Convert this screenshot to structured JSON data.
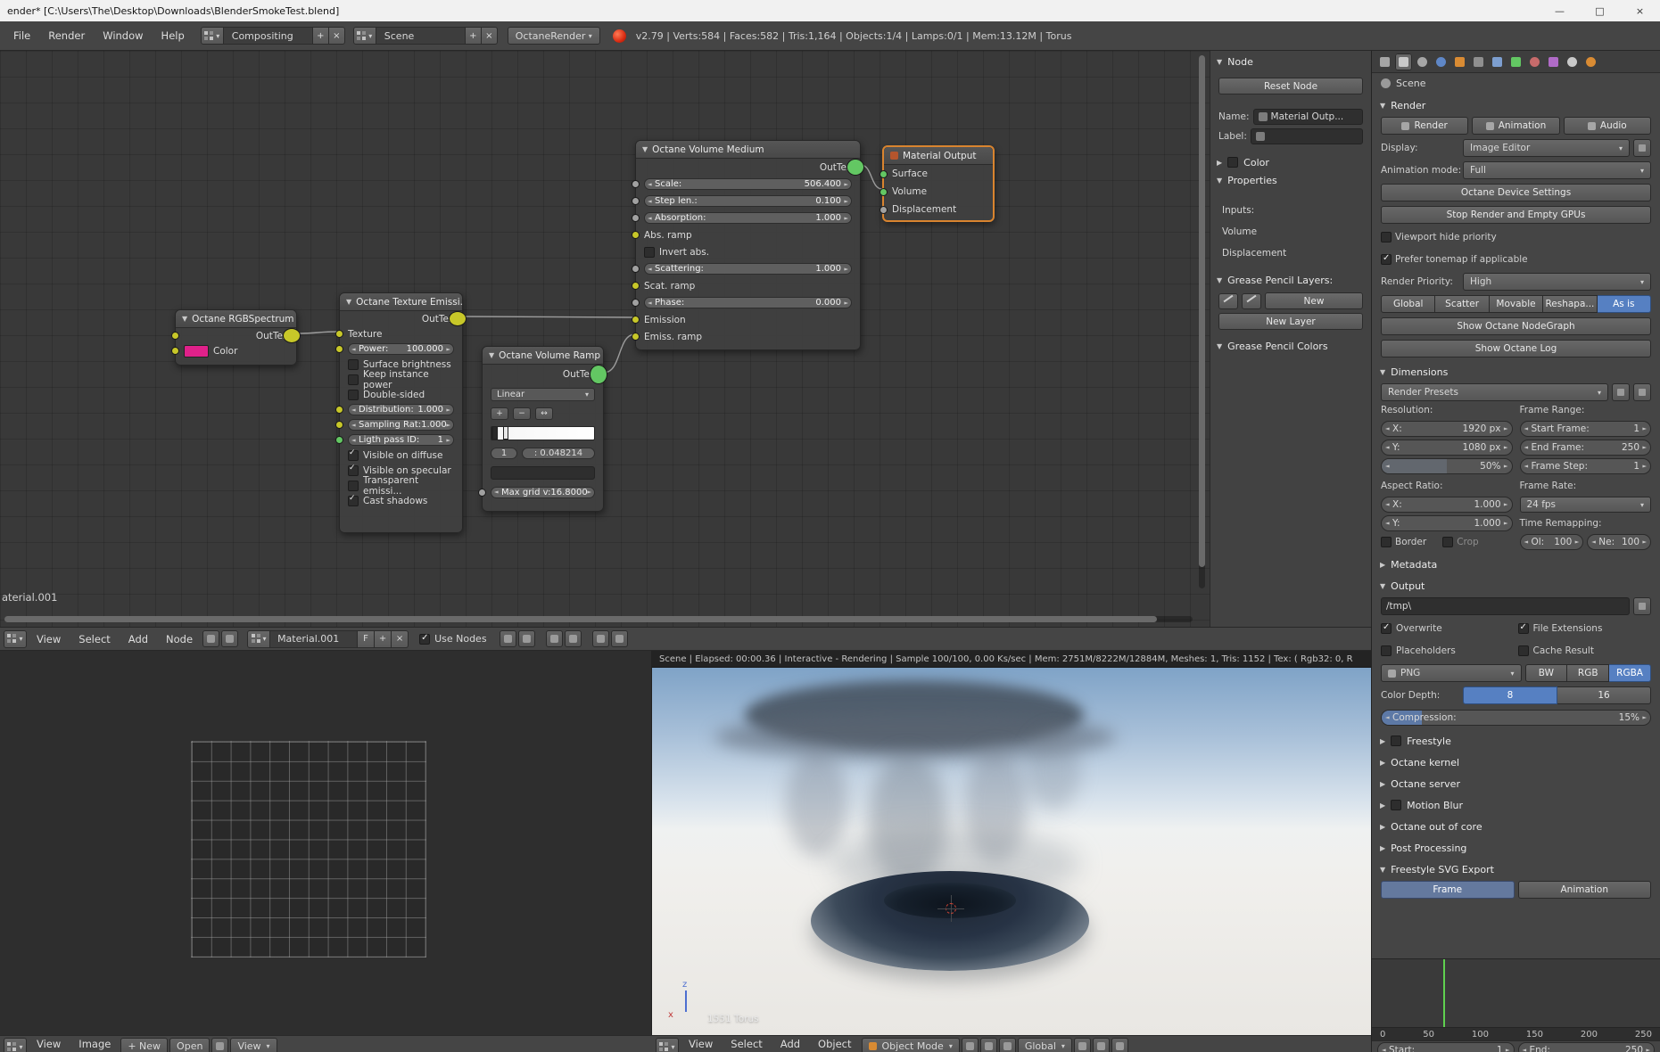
{
  "icons": {
    "tri_down": "▼",
    "tri_right": "▶",
    "plus": "+",
    "minus": "−",
    "close": "×",
    "minimize": "—",
    "maximize": "□",
    "swap": "↔",
    "dd": "▾"
  },
  "titlebar": {
    "title": "ender* [C:\\Users\\The\\Desktop\\Downloads\\BlenderSmokeTest.blend]"
  },
  "menubar": {
    "menus": [
      "File",
      "Render",
      "Window",
      "Help"
    ],
    "layout": "Compositing",
    "scene": "Scene",
    "engine": "OctaneRender",
    "stats": "v2.79 | Verts:584 | Faces:582 | Tris:1,164 | Objects:1/4 | Lamps:0/1 | Mem:13.12M | Torus"
  },
  "nodes": {
    "rgb": {
      "title": "Octane RGBSpectrum ...",
      "out": "OutTex",
      "color": "Color"
    },
    "emission": {
      "title": "Octane Texture Emissi...",
      "out": "OutTex",
      "texture": "Texture",
      "power_label": "Power:",
      "power_value": "100.000",
      "cb_surface": "Surface brightness",
      "cb_keep": "Keep instance power",
      "cb_double": "Double-sided",
      "dist_label": "Distribution:",
      "dist_value": "1.000",
      "samp_label": "Sampling Rat:",
      "samp_value": "1.000",
      "pass_label": "Ligth pass ID:",
      "pass_value": "1",
      "cb_diffuse": "Visible on diffuse",
      "cb_specular": "Visible on specular",
      "cb_transparent": "Transparent emissi...",
      "cb_shadows": "Cast shadows"
    },
    "ramp": {
      "title": "Octane Volume Ramp ...",
      "out": "OutTex",
      "interpolation": "Linear",
      "stop_index": "1",
      "stop_pos": ": 0.048214",
      "maxgrid_label": "Max grid v:",
      "maxgrid_value": "16.8000"
    },
    "medium": {
      "title": "Octane Volume Medium",
      "out": "OutTex",
      "scale_label": "Scale:",
      "scale_value": "506.400",
      "step_label": "Step len.:",
      "step_value": "0.100",
      "abs_label": "Absorption:",
      "abs_value": "1.000",
      "abs_ramp": "Abs. ramp",
      "cb_invert": "Invert abs.",
      "scat_label": "Scattering:",
      "scat_value": "1.000",
      "scat_ramp": "Scat. ramp",
      "phase_label": "Phase:",
      "phase_value": "0.000",
      "emission": "Emission",
      "emiss_ramp": "Emiss. ramp"
    },
    "output": {
      "title": "Material Output",
      "surface": "Surface",
      "volume": "Volume",
      "displacement": "Displacement"
    }
  },
  "npanel": {
    "node_section": "Node",
    "reset_button": "Reset Node",
    "name_label": "Name:",
    "name_value": "Material Outp...",
    "label_label": "Label:",
    "color_section": "Color",
    "properties_section": "Properties",
    "inputs_label": "Inputs:",
    "volume_label": "Volume",
    "displacement_label": "Displacement",
    "gp_layers_section": "Grease Pencil Layers:",
    "new_button": "New",
    "new_layer_button": "New Layer",
    "gp_colors_section": "Grease Pencil Colors"
  },
  "material_overlay": "aterial.001",
  "node_header": {
    "menus": [
      "View",
      "Select",
      "Add",
      "Node"
    ],
    "material": "Material.001",
    "fake_user": "F",
    "use_nodes": "Use Nodes"
  },
  "image_editor": {
    "menus": [
      "View",
      "Image"
    ],
    "new_button": "+ New",
    "open_button": "Open",
    "mode": "View"
  },
  "viewport": {
    "status": "Scene | Elapsed: 00:00.36 | Interactive - Rendering | Sample 100/100, 0.00 Ks/sec | Mem: 2751M/8222M/12884M, Meshes: 1, Tris: 1152 | Tex: ( Rgb32: 0, R",
    "object_label": "1551 Torus",
    "axis_x": "x",
    "axis_z": "z",
    "header_menus": [
      "View",
      "Select",
      "Add",
      "Object"
    ],
    "mode": "Object Mode",
    "orientation": "Global"
  },
  "properties": {
    "breadcrumb": "Scene",
    "render": {
      "section": "Render",
      "render_btn": "Render",
      "animation_btn": "Animation",
      "audio_btn": "Audio",
      "display_label": "Display:",
      "display_value": "Image Editor",
      "anim_mode_label": "Animation mode:",
      "anim_mode_value": "Full",
      "device_settings_btn": "Octane Device Settings",
      "stop_render_btn": "Stop Render and Empty GPUs",
      "viewport_hide_cb": "Viewport hide priority",
      "prefer_tonemap_cb": "Prefer tonemap if applicable",
      "priority_label": "Render Priority:",
      "priority_value": "High",
      "modes": [
        "Global",
        "Scatter",
        "Movable",
        "Reshapa...",
        "As is"
      ],
      "show_nodegraph_btn": "Show Octane NodeGraph",
      "show_log_btn": "Show Octane Log"
    },
    "dimensions": {
      "section": "Dimensions",
      "presets": "Render Presets",
      "resolution_label": "Resolution:",
      "frame_range_label": "Frame Range:",
      "res_x_label": "X:",
      "res_x_value": "1920 px",
      "res_y_label": "Y:",
      "res_y_value": "1080 px",
      "res_pct": "50%",
      "start_label": "Start Frame:",
      "start_value": "1",
      "end_label": "End Frame:",
      "end_value": "250",
      "step_label": "Frame Step:",
      "step_value": "1",
      "aspect_label": "Aspect Ratio:",
      "frame_rate_label": "Frame Rate:",
      "aspect_x_label": "X:",
      "aspect_x_value": "1.000",
      "aspect_y_label": "Y:",
      "aspect_y_value": "1.000",
      "fps_value": "24 fps",
      "remap_label": "Time Remapping:",
      "border_cb": "Border",
      "crop_cb": "Crop",
      "old_label": "Ol:",
      "old_value": "100",
      "new_label": "Ne:",
      "new_value": "100"
    },
    "metadata_section": "Metadata",
    "output": {
      "section": "Output",
      "path": "/tmp\\",
      "overwrite_cb": "Overwrite",
      "file_ext_cb": "File Extensions",
      "placeholders_cb": "Placeholders",
      "cache_cb": "Cache Result",
      "format": "PNG",
      "bw": "BW",
      "rgb": "RGB",
      "rgba": "RGBA",
      "depth_label": "Color Depth:",
      "depth_8": "8",
      "depth_16": "16",
      "compression_label": "Compression:",
      "compression_value": "15%"
    },
    "collapsed": {
      "freestyle": "Freestyle",
      "octane_kernel": "Octane kernel",
      "octane_server": "Octane server",
      "motion_blur": "Motion Blur",
      "octane_ooc": "Octane out of core",
      "post_processing": "Post Processing"
    },
    "svg_export": {
      "section": "Freestyle SVG Export",
      "frame_btn": "Frame",
      "animation_btn": "Animation"
    }
  },
  "timeline": {
    "ticks": [
      "0",
      "50",
      "100",
      "150",
      "200",
      "250"
    ],
    "start_label": "Start:",
    "start_value": "1",
    "end_label": "End:",
    "end_value": "250"
  },
  "colors": {
    "accent_blue": "#5680c2",
    "selected_node": "#d9842f",
    "socket_yellow": "#c7c729",
    "socket_green": "#63c763",
    "socket_gray": "#a1a1a1",
    "playhead_green": "#5fd14f"
  }
}
